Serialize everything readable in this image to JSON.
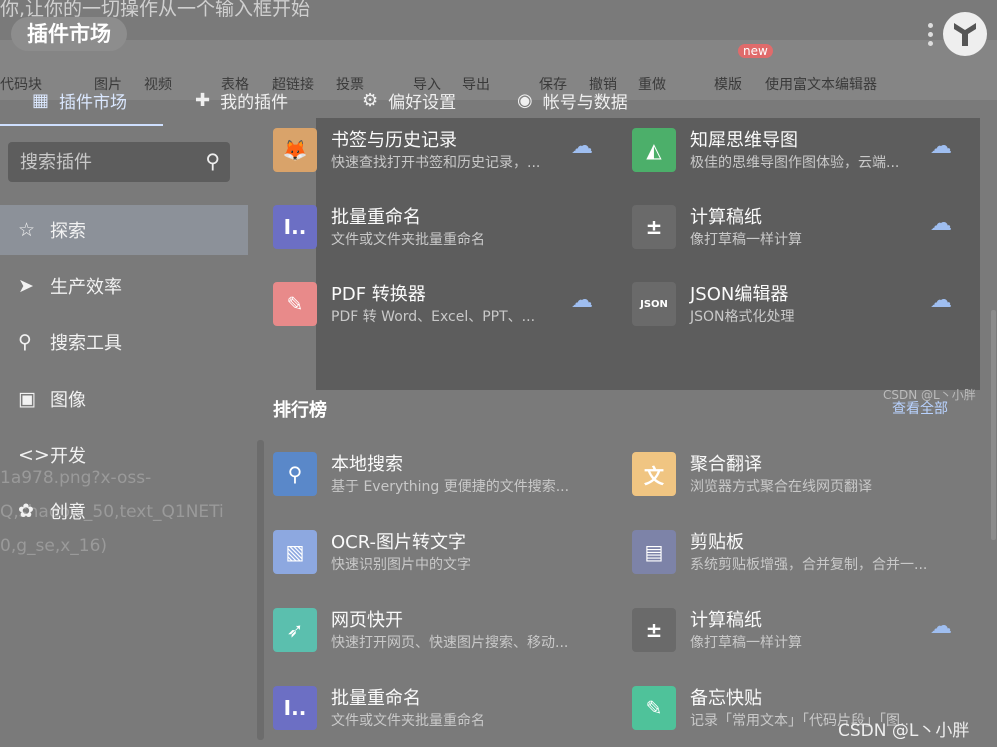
{
  "header": {
    "pill_title": "插件市场",
    "bg_caption": "你,让你的一切操作从一个输入框开始"
  },
  "toolbar_bg": {
    "items": [
      "代码块",
      "图片",
      "视频",
      "表格",
      "超链接",
      "投票",
      "导入",
      "导出",
      "保存",
      "撤销",
      "重做",
      "模版",
      "使用富文本编辑器"
    ],
    "new_badge": "new"
  },
  "nav": {
    "tabs": [
      {
        "label": "插件市场",
        "icon": "grid-icon"
      },
      {
        "label": "我的插件",
        "icon": "puzzle-icon"
      },
      {
        "label": "偏好设置",
        "icon": "gear-icon"
      },
      {
        "label": "帐号与数据",
        "icon": "user-icon"
      }
    ]
  },
  "sidebar": {
    "search_placeholder": "搜索插件",
    "items": [
      {
        "label": "探索",
        "icon": "star-icon"
      },
      {
        "label": "生产效率",
        "icon": "send-icon"
      },
      {
        "label": "搜索工具",
        "icon": "search-icon"
      },
      {
        "label": "图像",
        "icon": "image-icon"
      },
      {
        "label": "开发",
        "icon": "code-icon"
      },
      {
        "label": "创意",
        "icon": "palette-icon"
      }
    ],
    "bg_text": [
      "1a978.png?x-oss-",
      "Q,shadow_50,text_Q1NETi",
      "0,g_se,x_16)"
    ]
  },
  "featured": [
    {
      "title": "书签与历史记录",
      "desc": "快速查找打开书签和历史记录，...",
      "icon": "fox-icon",
      "color": "#d9a36a",
      "download": true
    },
    {
      "title": "知犀思维导图",
      "desc": "极佳的思维导图作图体验，云端...",
      "icon": "rhino-icon",
      "color": "#4caf6a",
      "download": true
    },
    {
      "title": "批量重命名",
      "desc": "文件或文件夹批量重命名",
      "icon": "rename-icon",
      "color": "#6c6fc4",
      "download": false
    },
    {
      "title": "计算稿纸",
      "desc": "像打草稿一样计算",
      "icon": "calc-icon",
      "color": "#6a6a6a",
      "download": true
    },
    {
      "title": "PDF 转换器",
      "desc": "PDF 转 Word、Excel、PPT、...",
      "icon": "pdf-icon",
      "color": "#e88a8a",
      "download": true
    },
    {
      "title": "JSON编辑器",
      "desc": "JSON格式化处理",
      "icon": "json-icon",
      "color": "#6a6a6a",
      "download": true
    }
  ],
  "ranking": {
    "title": "排行榜",
    "view_all": "查看全部",
    "items": [
      {
        "title": "本地搜索",
        "desc": "基于 Everything 更便捷的文件搜索...",
        "icon": "search-icon",
        "color": "#5a88c9",
        "download": false
      },
      {
        "title": "聚合翻译",
        "desc": "浏览器方式聚合在线网页翻译",
        "icon": "translate-icon",
        "color": "#f0c582",
        "download": false
      },
      {
        "title": "OCR-图片转文字",
        "desc": "快速识别图片中的文字",
        "icon": "ocr-icon",
        "color": "#8da8e0",
        "download": false
      },
      {
        "title": "剪贴板",
        "desc": "系统剪贴板增强，合并复制，合并一...",
        "icon": "clipboard-icon",
        "color": "#7d83a8",
        "download": false
      },
      {
        "title": "网页快开",
        "desc": "快速打开网页、快速图片搜索、移动...",
        "icon": "rocket-icon",
        "color": "#5bbfae",
        "download": false
      },
      {
        "title": "计算稿纸",
        "desc": "像打草稿一样计算",
        "icon": "calc-icon",
        "color": "#6a6a6a",
        "download": true
      },
      {
        "title": "批量重命名",
        "desc": "文件或文件夹批量重命名",
        "icon": "rename-icon",
        "color": "#6c6fc4",
        "download": false
      },
      {
        "title": "备忘快贴",
        "desc": "记录「常用文本」「代码片段」「图...",
        "icon": "memo-icon",
        "color": "#4fc29a",
        "download": false
      }
    ]
  },
  "watermarks": {
    "main": "CSDN @L丶小胖",
    "inner": "CSDN @L丶小胖"
  }
}
